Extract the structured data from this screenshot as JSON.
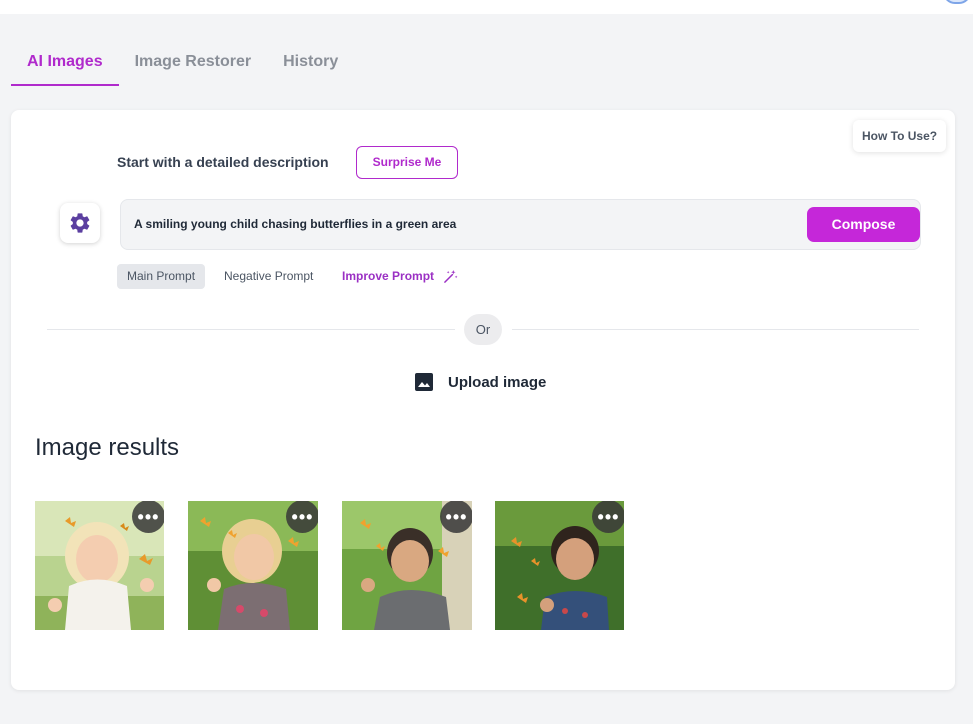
{
  "tabs": [
    {
      "label": "AI Images",
      "active": true
    },
    {
      "label": "Image Restorer",
      "active": false
    },
    {
      "label": "History",
      "active": false
    }
  ],
  "help": {
    "label": "How To Use?"
  },
  "prompt_section": {
    "label": "Start with a detailed description",
    "surprise_label": "Surprise Me",
    "prompt_value": "A smiling young child chasing butterflies in a green area",
    "compose_label": "Compose",
    "settings_icon": "gear-icon"
  },
  "prompt_tabs": {
    "main": "Main Prompt",
    "negative": "Negative Prompt",
    "improve": "Improve Prompt",
    "improve_icon": "magic-wand-icon"
  },
  "divider": {
    "label": "Or"
  },
  "upload": {
    "label": "Upload image",
    "icon": "image-icon"
  },
  "results": {
    "title": "Image results",
    "images": [
      {
        "icon": "more-options-icon",
        "more_label": "•••"
      },
      {
        "icon": "more-options-icon",
        "more_label": "•••"
      },
      {
        "icon": "more-options-icon",
        "more_label": "•••"
      },
      {
        "icon": "more-options-icon",
        "more_label": "•••"
      }
    ]
  },
  "colors": {
    "accent": "#b02acc",
    "compose": "#c527d9",
    "background": "#f3f4f6"
  }
}
